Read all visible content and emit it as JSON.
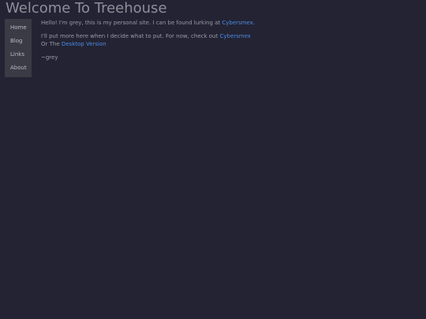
{
  "header": {
    "title": "Welcome To Treehouse"
  },
  "nav": {
    "items": [
      {
        "label": "Home"
      },
      {
        "label": "Blog"
      },
      {
        "label": "Links"
      },
      {
        "label": "About"
      }
    ]
  },
  "content": {
    "intro_text": "Hello! I'm grey, this is my personal site. I can be found lurking at ",
    "intro_link": "Cybersmex",
    "intro_end": ".",
    "more_text": "I'll put more here when I decide what to put. For now, check out ",
    "more_link": "Cybersmex",
    "or_text": "Or The ",
    "desktop_link": "Desktop Version",
    "signature": "~grey"
  },
  "colors": {
    "background": "#232333",
    "nav_background": "#3a3b45",
    "link": "#4a8be8",
    "title": "#8f8f9b"
  }
}
